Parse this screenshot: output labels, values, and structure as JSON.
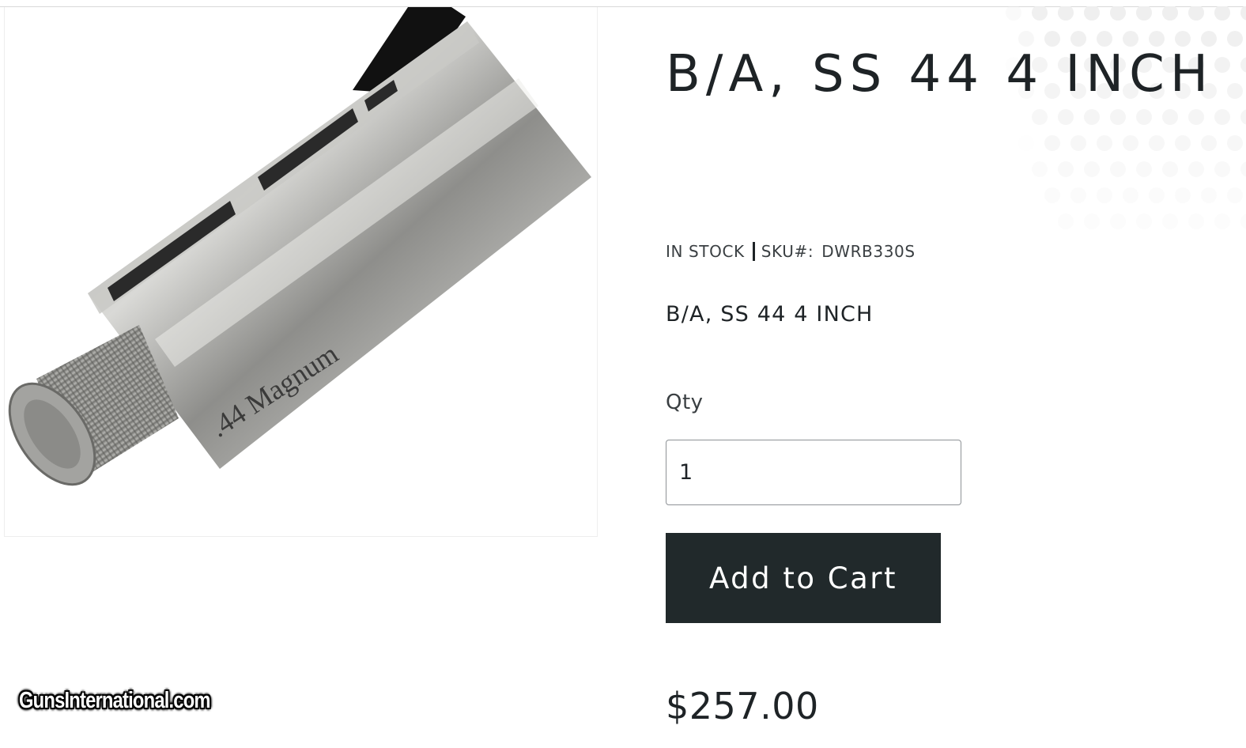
{
  "product": {
    "title": "B/A, SS 44 4 INCH",
    "stock_status": "IN STOCK",
    "sku_label": "SKU#:",
    "sku_value": "DWRB330S",
    "description": "B/A, SS 44 4 INCH",
    "image_engraving": ".44 Magnum",
    "image_icon": "revolver-barrel-image"
  },
  "purchase": {
    "qty_label": "Qty",
    "qty_value": "1",
    "add_to_cart_label": "Add to Cart",
    "price": "$257.00"
  },
  "watermark": {
    "text": "GunsInternational.com"
  },
  "colors": {
    "button_bg": "#21292b",
    "button_text": "#ffffff",
    "text_primary": "#1e2326",
    "input_border": "#8e9296"
  }
}
